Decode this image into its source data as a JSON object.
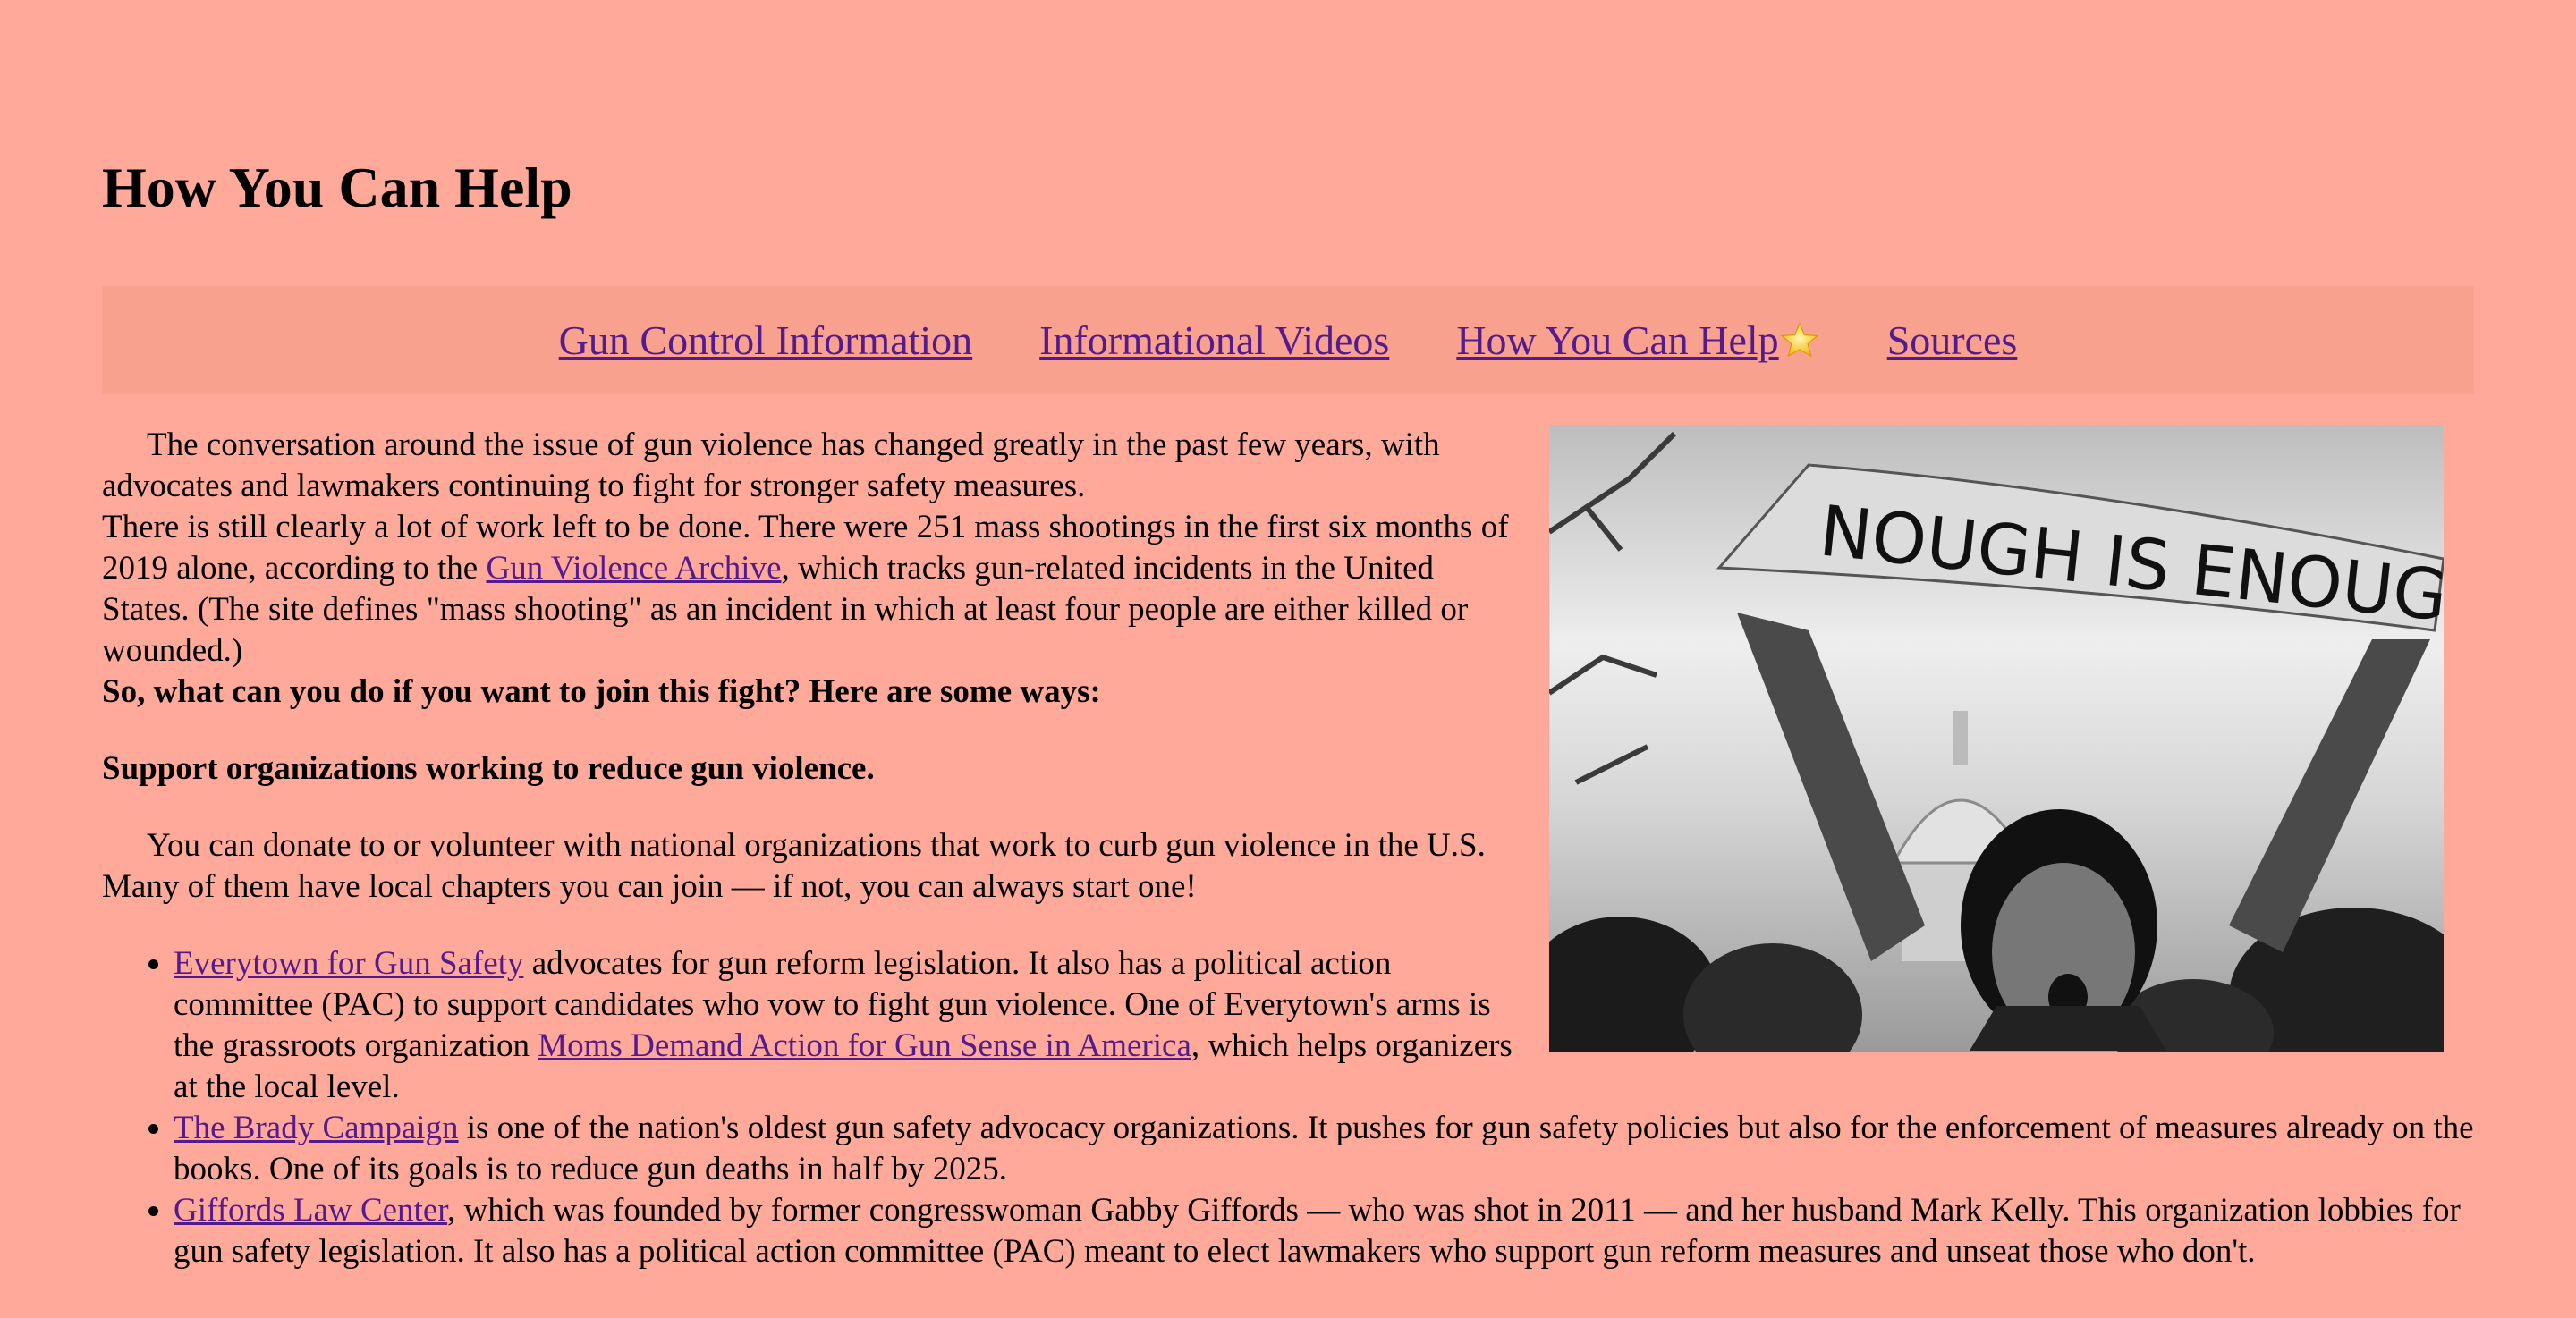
{
  "page": {
    "title": "How You Can Help"
  },
  "nav": {
    "items": [
      {
        "label": "Gun Control Information"
      },
      {
        "label": "Informational Videos"
      },
      {
        "label": "How You Can Help",
        "icon": "star-icon"
      },
      {
        "label": "Sources"
      }
    ]
  },
  "hero_image": {
    "sign_text": "NOUGH IS ENOUGH"
  },
  "intro": {
    "p1": "The conversation around the issue of gun violence has changed greatly in the past few years, with advocates and lawmakers continuing to fight for stronger safety measures.",
    "p2_before": "There is still clearly a lot of work left to be done. There were 251 mass shootings in the first six months of 2019 alone, according to the ",
    "p2_link": "Gun Violence Archive",
    "p2_after": ", which tracks gun-related incidents in the United States. (The site defines \"mass shooting\" as an incident in which at least four people are either killed or wounded.)",
    "question": "So, what can you do if you want to join this fight? Here are some ways:"
  },
  "section1": {
    "heading": "Support organizations working to reduce gun violence.",
    "body": "You can donate to or volunteer with national organizations that work to curb gun violence in the U.S. Many of them have local chapters you can join — if not, you can always start one!"
  },
  "orgs": [
    {
      "link": "Everytown for Gun Safety",
      "text1": " advocates for gun reform legislation. It also has a political action committee (PAC) to support candidates who vow to fight gun violence. One of Everytown's arms is the grassroots organization ",
      "link2": "Moms Demand Action for Gun Sense in America",
      "text2": ", which helps organizers at the local level."
    },
    {
      "link": "The Brady Campaign",
      "text1": " is one of the nation's oldest gun safety advocacy organizations. It pushes for gun safety policies but also for the enforcement of measures already on the books. One of its goals is to reduce gun deaths in half by 2025."
    },
    {
      "link": "Giffords Law Center",
      "text1": ", which was founded by former congresswoman Gabby Giffords — who was shot in 2011 — and her husband Mark Kelly. This organization lobbies for gun safety legislation. It also has a political action committee (PAC) meant to elect lawmakers who support gun reform measures and unseat those who don't."
    }
  ],
  "colors": {
    "background": "#ffa99a",
    "nav_background": "#f8a18e",
    "link": "#551a8b"
  }
}
